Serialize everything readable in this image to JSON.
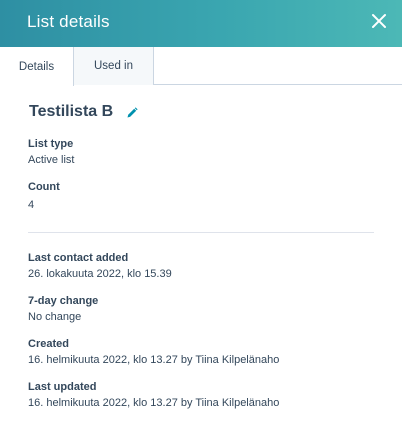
{
  "header": {
    "title": "List details"
  },
  "tabs": [
    {
      "label": "Details"
    },
    {
      "label": "Used in"
    }
  ],
  "list": {
    "name": "Testilista B"
  },
  "fields": {
    "list_type": {
      "label": "List type",
      "value": "Active list"
    },
    "count": {
      "label": "Count",
      "value": "4"
    },
    "last_contact_added": {
      "label": "Last contact added",
      "value": "26. lokakuuta 2022, klo 15.39"
    },
    "seven_day_change": {
      "label": "7-day change",
      "value": "No change"
    },
    "created": {
      "label": "Created",
      "value": "16. helmikuuta 2022, klo 13.27 by Tiina Kilpelänaho"
    },
    "last_updated": {
      "label": "Last updated",
      "value": "16. helmikuuta 2022, klo 13.27 by Tiina Kilpelänaho"
    }
  },
  "icons": {
    "close": "close-icon",
    "edit": "pencil-icon"
  },
  "colors": {
    "header_start": "#2e8fa3",
    "header_end": "#4cb8b6",
    "edit_icon": "#0091ae"
  }
}
